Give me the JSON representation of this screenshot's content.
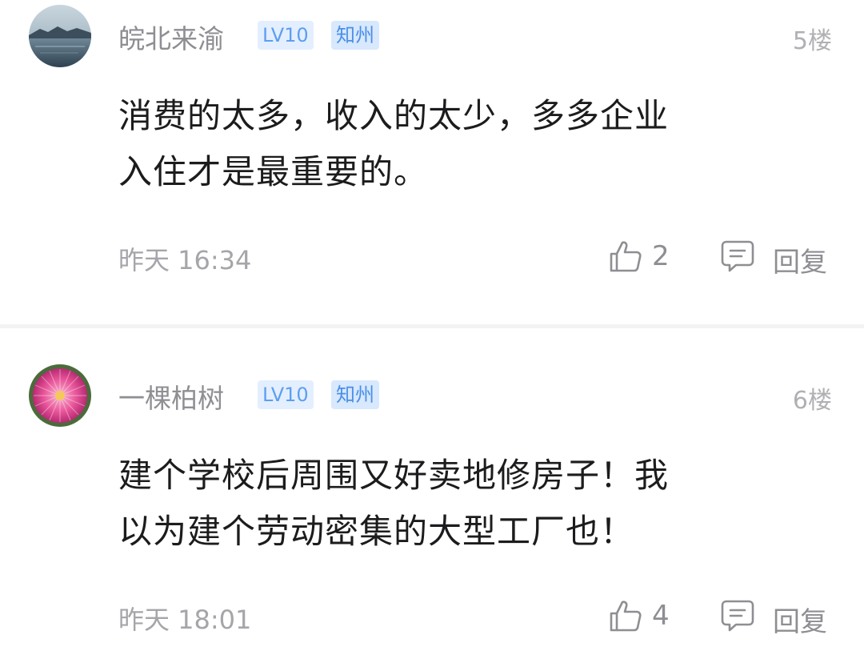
{
  "comments": [
    {
      "username": "皖北来渝",
      "level": "LV10",
      "location": "知州",
      "floor": "5楼",
      "content_lines": [
        "消费的太多，收入的太少，多多企业",
        "入住才是最重要的。"
      ],
      "time": "昨天 16:34",
      "likes": "2",
      "reply_label": "回复",
      "avatar": "lake-landscape"
    },
    {
      "username": "一棵柏树",
      "level": "LV10",
      "location": "知州",
      "floor": "6楼",
      "content_lines": [
        "建个学校后周围又好卖地修房子！我",
        "以为建个劳动密集的大型工厂也！"
      ],
      "time": "昨天 18:01",
      "likes": "4",
      "reply_label": "回复",
      "avatar": "pink-dahlia-flower"
    }
  ],
  "icons": {
    "like": "thumbs-up-icon",
    "reply": "comment-bubble-icon"
  },
  "colors": {
    "badge_text": "#5d9ef0",
    "badge_bg": "#e3efff",
    "username": "#8e8e93",
    "content": "#1c1c1e"
  }
}
